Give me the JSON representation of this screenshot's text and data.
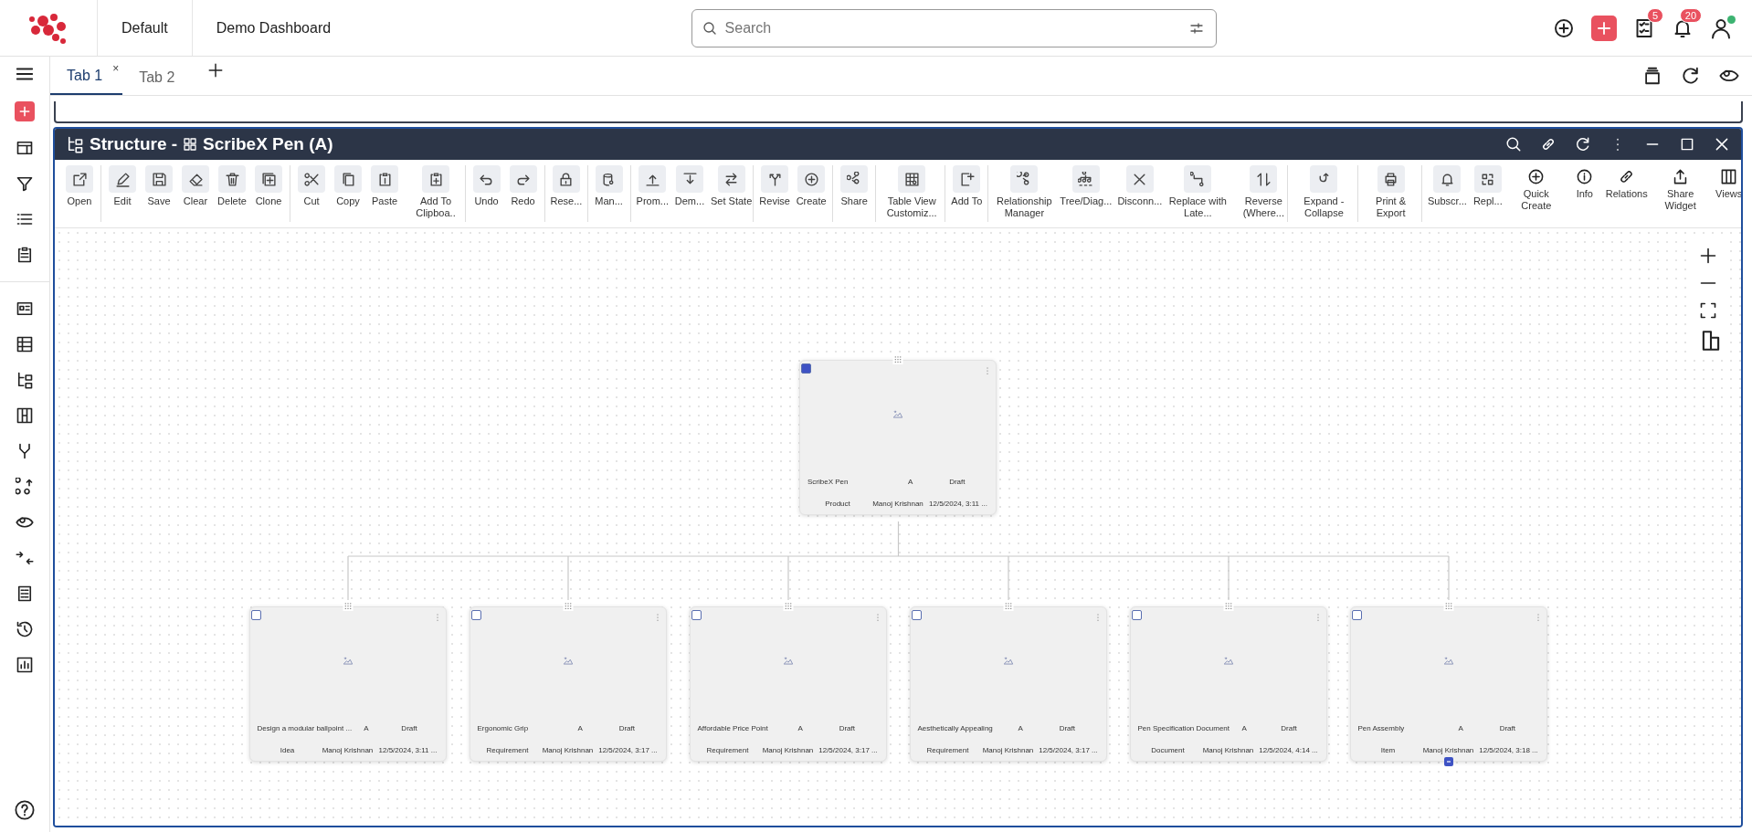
{
  "top_bar": {
    "workspace": "Default",
    "dashboard": "Demo Dashboard",
    "search": {
      "placeholder": "Search"
    },
    "task_count": "5",
    "notification_count": "20",
    "user_online": true
  },
  "tabs": [
    {
      "label": "Tab 1",
      "selected": true,
      "close": "×"
    },
    {
      "label": "Tab 2",
      "selected": false
    }
  ],
  "widget": {
    "title": "Structure - ",
    "object": "ScribeX Pen (A)"
  },
  "toolbar": [
    [
      {
        "label": "Open",
        "kind": "boxed"
      }
    ],
    [
      {
        "label": "Edit",
        "kind": "boxed"
      },
      {
        "label": "Save",
        "kind": "boxed"
      },
      {
        "label": "Clear",
        "kind": "boxed"
      },
      {
        "label": "Delete",
        "kind": "boxed"
      },
      {
        "label": "Clone",
        "kind": "boxed"
      }
    ],
    [
      {
        "label": "Cut",
        "kind": "boxed"
      },
      {
        "label": "Copy",
        "kind": "boxed"
      },
      {
        "label": "Paste",
        "kind": "boxed"
      },
      {
        "label": "Add To Clipboa..",
        "kind": "boxed"
      }
    ],
    [
      {
        "label": "Undo",
        "kind": "boxed"
      },
      {
        "label": "Redo",
        "kind": "boxed"
      }
    ],
    [
      {
        "label": "Rese...",
        "kind": "boxed"
      }
    ],
    [
      {
        "label": "Man...",
        "kind": "boxed"
      }
    ],
    [
      {
        "label": "Prom...",
        "kind": "boxed"
      },
      {
        "label": "Dem...",
        "kind": "boxed"
      },
      {
        "label": "Set State",
        "kind": "boxed"
      }
    ],
    [
      {
        "label": "Revise",
        "kind": "boxed"
      },
      {
        "label": "Create",
        "kind": "boxed"
      }
    ],
    [
      {
        "label": "Share",
        "kind": "boxed"
      }
    ],
    [
      {
        "label": "Table View Customiz...",
        "kind": "boxed"
      }
    ],
    [
      {
        "label": "Add To",
        "kind": "boxed"
      }
    ],
    [
      {
        "label": "Relationship Manager",
        "kind": "boxed"
      },
      {
        "label": "Tree/Diag...",
        "kind": "boxed"
      },
      {
        "label": "Disconn...",
        "kind": "boxed"
      },
      {
        "label": "Replace with Late...",
        "kind": "boxed"
      },
      {
        "label": "Reverse (Where...",
        "kind": "boxed"
      }
    ],
    [
      {
        "label": "Expand - Collapse",
        "kind": "boxed"
      }
    ],
    [
      {
        "label": "Print & Export",
        "kind": "boxed"
      }
    ],
    [
      {
        "label": "Subscr...",
        "kind": "boxed"
      },
      {
        "label": "Repl...",
        "kind": "boxed"
      },
      {
        "label": "Quick Create",
        "kind": "plain"
      },
      {
        "label": "Info",
        "kind": "plain"
      },
      {
        "label": "Relations",
        "kind": "plain"
      },
      {
        "label": "Share Widget",
        "kind": "plain"
      },
      {
        "label": "Views",
        "kind": "plain"
      }
    ]
  ],
  "root_node": {
    "name": "ScribeX Pen",
    "revision": "A",
    "state": "Draft",
    "type": "Product",
    "owner": "Manoj Krishnan",
    "date": "12/5/2024, 3:11 ...",
    "selected": true,
    "expand_button": false
  },
  "child_nodes": [
    {
      "name": "Design a modular ballpoint ...",
      "revision": "A",
      "state": "Draft",
      "type": "Idea",
      "owner": "Manoj Krishnan",
      "date": "12/5/2024, 3:11 ...",
      "selected": false,
      "expand_button": false
    },
    {
      "name": "Ergonomic Grip",
      "revision": "A",
      "state": "Draft",
      "type": "Requirement",
      "owner": "Manoj Krishnan",
      "date": "12/5/2024, 3:17 ...",
      "selected": false,
      "expand_button": false
    },
    {
      "name": "Affordable Price Point",
      "revision": "A",
      "state": "Draft",
      "type": "Requirement",
      "owner": "Manoj Krishnan",
      "date": "12/5/2024, 3:17 ...",
      "selected": false,
      "expand_button": false
    },
    {
      "name": "Aesthetically Appealing",
      "revision": "A",
      "state": "Draft",
      "type": "Requirement",
      "owner": "Manoj Krishnan",
      "date": "12/5/2024, 3:17 ...",
      "selected": false,
      "expand_button": false
    },
    {
      "name": "Pen Specification Document",
      "revision": "A",
      "state": "Draft",
      "type": "Document",
      "owner": "Manoj Krishnan",
      "date": "12/5/2024, 4:14 ...",
      "selected": false,
      "expand_button": false
    },
    {
      "name": "Pen Assembly",
      "revision": "A",
      "state": "Draft",
      "type": "Item",
      "owner": "Manoj Krishnan",
      "date": "12/5/2024, 3:18 ...",
      "selected": false,
      "expand_button": true
    }
  ]
}
